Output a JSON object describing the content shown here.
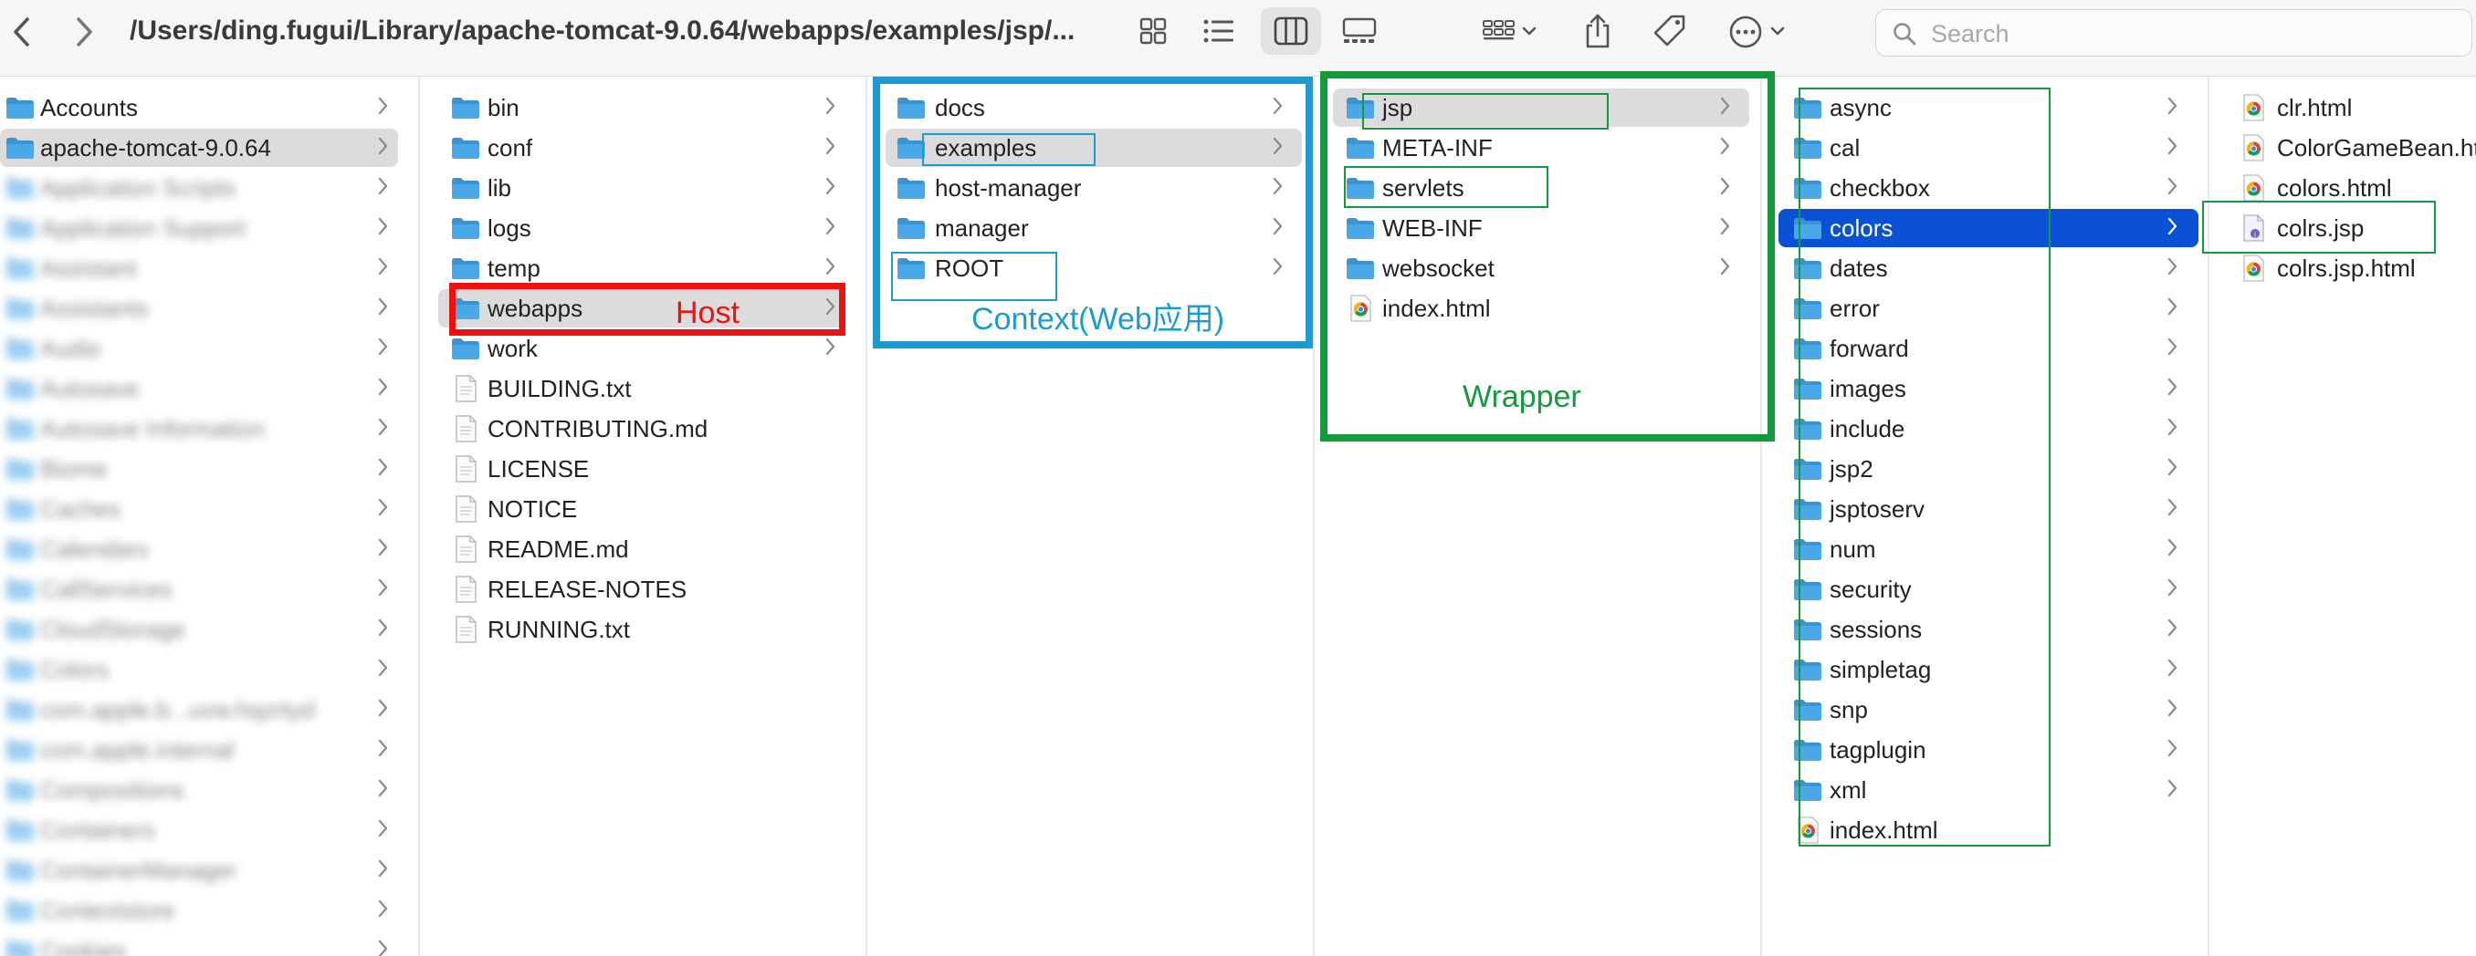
{
  "window": {
    "path": "/Users/ding.fugui/Library/apache-tomcat-9.0.64/webapps/examples/jsp/...",
    "search_placeholder": "Search"
  },
  "icons": {
    "back": "chevron-left-icon",
    "forward": "chevron-right-icon",
    "view_icons": "grid-view-icon",
    "view_list": "list-view-icon",
    "view_columns": "column-view-icon",
    "view_gallery": "gallery-view-icon",
    "group": "group-by-icon",
    "share": "share-icon",
    "tag": "tag-icon",
    "more": "ellipsis-icon",
    "search": "search-icon",
    "folder": "folder-icon",
    "chrome_html": "chrome-html-file-icon",
    "text_file": "text-file-icon",
    "jsp_file": "jsp-file-icon"
  },
  "colors": {
    "folder": "#4aa8e8",
    "folder_dark": "#3b93d4",
    "selection_blue": "#0a51d6",
    "selection_grey": "#dcdcdc",
    "host_red": "#ee1111",
    "context_blue": "#1d9bd1",
    "wrapper_green": "#149a3c"
  },
  "columns": [
    {
      "name": "library",
      "items": [
        {
          "label": "Accounts",
          "icon": "folder",
          "chevron": true
        },
        {
          "label": "apache-tomcat-9.0.64",
          "icon": "folder",
          "chevron": true,
          "selected": "grey"
        },
        {
          "label": "Application Scripts",
          "icon": "folder",
          "chevron": true,
          "blurred": true
        },
        {
          "label": "Application Support",
          "icon": "folder",
          "chevron": true,
          "blurred": true
        },
        {
          "label": "Assistant",
          "icon": "folder",
          "chevron": true,
          "blurred": true
        },
        {
          "label": "Assistants",
          "icon": "folder",
          "chevron": true,
          "blurred": true
        },
        {
          "label": "Audio",
          "icon": "folder",
          "chevron": true,
          "blurred": true
        },
        {
          "label": "Autosave",
          "icon": "folder",
          "chevron": true,
          "blurred": true
        },
        {
          "label": "Autosave Information",
          "icon": "folder",
          "chevron": true,
          "blurred": true
        },
        {
          "label": "Biome",
          "icon": "folder",
          "chevron": true,
          "blurred": true
        },
        {
          "label": "Caches",
          "icon": "folder",
          "chevron": true,
          "blurred": true
        },
        {
          "label": "Calendars",
          "icon": "folder",
          "chevron": true,
          "blurred": true
        },
        {
          "label": "CallServices",
          "icon": "folder",
          "chevron": true,
          "blurred": true
        },
        {
          "label": "CloudStorage",
          "icon": "folder",
          "chevron": true,
          "blurred": true
        },
        {
          "label": "Colors",
          "icon": "folder",
          "chevron": true,
          "blurred": true
        },
        {
          "label": "com.apple.b...uvw.hqzrtyd",
          "icon": "folder",
          "chevron": true,
          "blurred": true
        },
        {
          "label": "com.apple.internal",
          "icon": "folder",
          "chevron": true,
          "blurred": true
        },
        {
          "label": "Compositions",
          "icon": "folder",
          "chevron": true,
          "blurred": true
        },
        {
          "label": "Containers",
          "icon": "folder",
          "chevron": true,
          "blurred": true
        },
        {
          "label": "ContainerManager",
          "icon": "folder",
          "chevron": true,
          "blurred": true
        },
        {
          "label": "Contextstore",
          "icon": "folder",
          "chevron": true,
          "blurred": true
        },
        {
          "label": "Cookies",
          "icon": "folder",
          "chevron": true,
          "blurred": true
        }
      ]
    },
    {
      "name": "tomcat",
      "items": [
        {
          "label": "bin",
          "icon": "folder",
          "chevron": true
        },
        {
          "label": "conf",
          "icon": "folder",
          "chevron": true
        },
        {
          "label": "lib",
          "icon": "folder",
          "chevron": true
        },
        {
          "label": "logs",
          "icon": "folder",
          "chevron": true
        },
        {
          "label": "temp",
          "icon": "folder",
          "chevron": true
        },
        {
          "label": "webapps",
          "icon": "folder",
          "chevron": true,
          "selected": "grey"
        },
        {
          "label": "work",
          "icon": "folder",
          "chevron": true
        },
        {
          "label": "BUILDING.txt",
          "icon": "text_file"
        },
        {
          "label": "CONTRIBUTING.md",
          "icon": "text_file"
        },
        {
          "label": "LICENSE",
          "icon": "text_file"
        },
        {
          "label": "NOTICE",
          "icon": "text_file"
        },
        {
          "label": "README.md",
          "icon": "text_file"
        },
        {
          "label": "RELEASE-NOTES",
          "icon": "text_file"
        },
        {
          "label": "RUNNING.txt",
          "icon": "text_file"
        }
      ]
    },
    {
      "name": "webapps",
      "items": [
        {
          "label": "docs",
          "icon": "folder",
          "chevron": true
        },
        {
          "label": "examples",
          "icon": "folder",
          "chevron": true,
          "selected": "grey"
        },
        {
          "label": "host-manager",
          "icon": "folder",
          "chevron": true
        },
        {
          "label": "manager",
          "icon": "folder",
          "chevron": true
        },
        {
          "label": "ROOT",
          "icon": "folder",
          "chevron": true
        }
      ]
    },
    {
      "name": "examples",
      "items": [
        {
          "label": "jsp",
          "icon": "folder",
          "chevron": true,
          "selected": "grey"
        },
        {
          "label": "META-INF",
          "icon": "folder",
          "chevron": true
        },
        {
          "label": "servlets",
          "icon": "folder",
          "chevron": true
        },
        {
          "label": "WEB-INF",
          "icon": "folder",
          "chevron": true
        },
        {
          "label": "websocket",
          "icon": "folder",
          "chevron": true
        },
        {
          "label": "index.html",
          "icon": "chrome_html"
        }
      ]
    },
    {
      "name": "jsp",
      "items": [
        {
          "label": "async",
          "icon": "folder",
          "chevron": true
        },
        {
          "label": "cal",
          "icon": "folder",
          "chevron": true
        },
        {
          "label": "checkbox",
          "icon": "folder",
          "chevron": true
        },
        {
          "label": "colors",
          "icon": "folder",
          "chevron": true,
          "selected": "blue"
        },
        {
          "label": "dates",
          "icon": "folder",
          "chevron": true
        },
        {
          "label": "error",
          "icon": "folder",
          "chevron": true
        },
        {
          "label": "forward",
          "icon": "folder",
          "chevron": true
        },
        {
          "label": "images",
          "icon": "folder",
          "chevron": true
        },
        {
          "label": "include",
          "icon": "folder",
          "chevron": true
        },
        {
          "label": "jsp2",
          "icon": "folder",
          "chevron": true
        },
        {
          "label": "jsptoserv",
          "icon": "folder",
          "chevron": true
        },
        {
          "label": "num",
          "icon": "folder",
          "chevron": true
        },
        {
          "label": "security",
          "icon": "folder",
          "chevron": true
        },
        {
          "label": "sessions",
          "icon": "folder",
          "chevron": true
        },
        {
          "label": "simpletag",
          "icon": "folder",
          "chevron": true
        },
        {
          "label": "snp",
          "icon": "folder",
          "chevron": true
        },
        {
          "label": "tagplugin",
          "icon": "folder",
          "chevron": true
        },
        {
          "label": "xml",
          "icon": "folder",
          "chevron": true
        },
        {
          "label": "index.html",
          "icon": "chrome_html"
        }
      ]
    },
    {
      "name": "colors",
      "items": [
        {
          "label": "clr.html",
          "icon": "chrome_html"
        },
        {
          "label": "ColorGameBean.html",
          "icon": "chrome_html"
        },
        {
          "label": "colors.html",
          "icon": "chrome_html"
        },
        {
          "label": "colrs.jsp",
          "icon": "jsp_file"
        },
        {
          "label": "colrs.jsp.html",
          "icon": "chrome_html"
        }
      ]
    }
  ],
  "annotations": {
    "host_label": "Host",
    "context_label": "Context(Web应用)",
    "wrapper_label": "Wrapper"
  }
}
